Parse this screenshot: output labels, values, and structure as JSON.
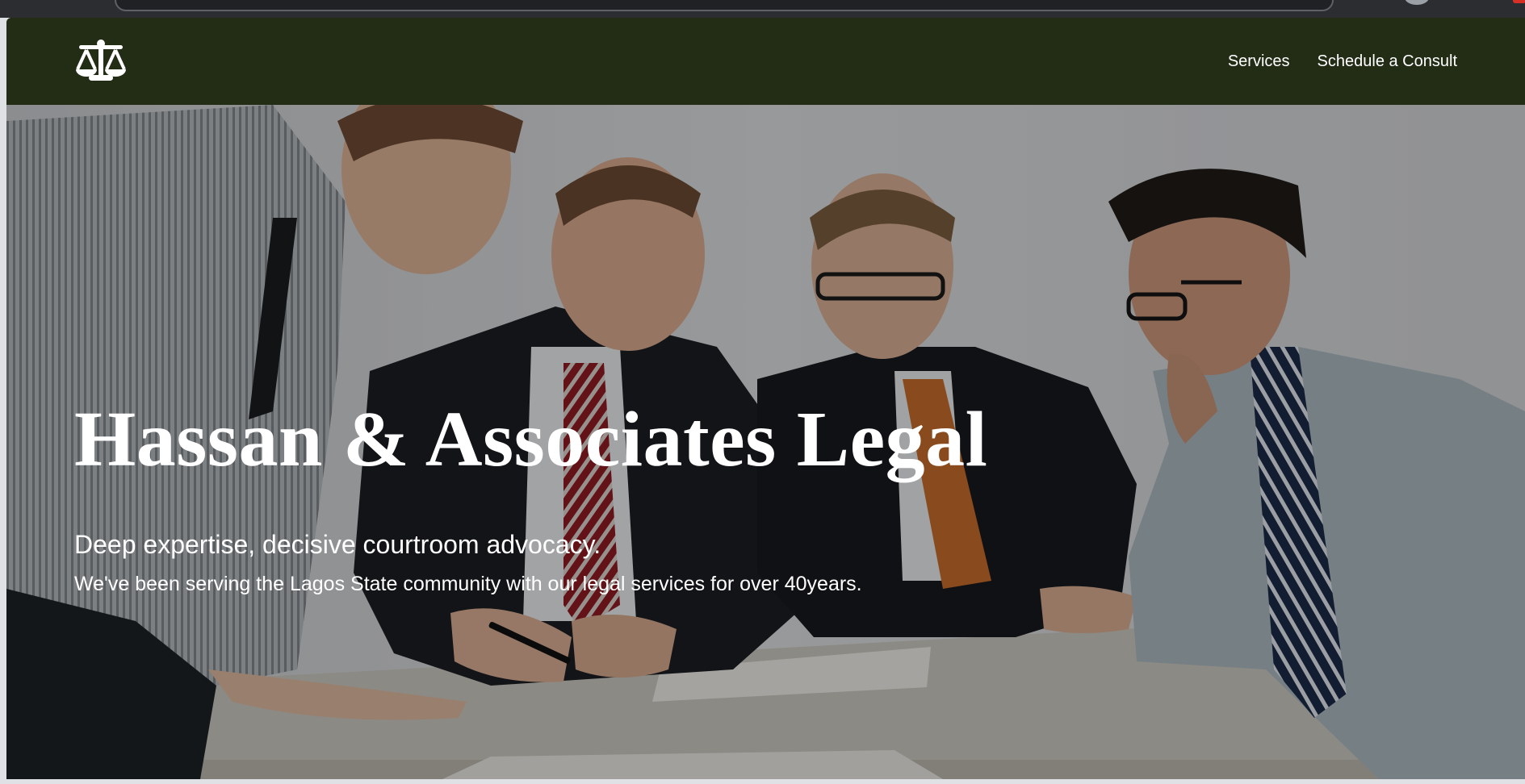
{
  "brand": {
    "logo_icon": "scales-of-justice-icon"
  },
  "nav": {
    "links": [
      {
        "label": "Services"
      },
      {
        "label": "Schedule a Consult"
      }
    ]
  },
  "hero": {
    "title": "Hassan & Associates Legal",
    "tagline": "Deep expertise, decisive courtroom advocacy.",
    "description": "We've been serving the Lagos State community with our legal services for over 40years."
  },
  "colors": {
    "navbar_bg": "#232d16",
    "text": "#ffffff"
  }
}
